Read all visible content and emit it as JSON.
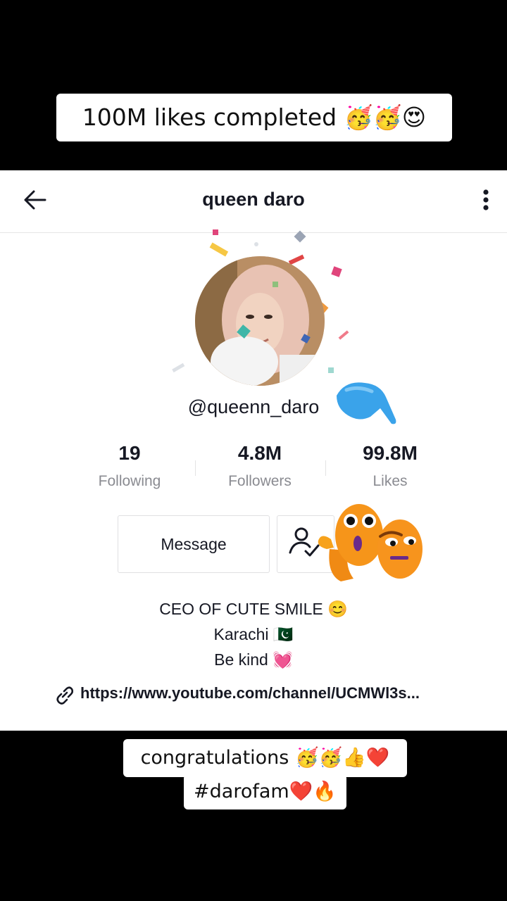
{
  "overlay": {
    "top_caption": "100M likes completed 🥳🥳😍",
    "bottom_caption_line1": "congratulations 🥳🥳👍❤️",
    "bottom_caption_line2": "#darofam❤️🔥"
  },
  "header": {
    "title": "queen daro",
    "back_icon": "arrow-left-icon",
    "more_icon": "more-vertical-icon"
  },
  "profile": {
    "username": "@queenn_daro",
    "stats": [
      {
        "value": "19",
        "label": "Following"
      },
      {
        "value": "4.8M",
        "label": "Followers"
      },
      {
        "value": "99.8M",
        "label": "Likes"
      }
    ],
    "message_label": "Message",
    "follow_icon": "user-check-icon",
    "bio": {
      "line1": "CEO OF CUTE SMILE 😊",
      "line2": "Karachi 🇵🇰",
      "line3": "Be kind 💓"
    },
    "link": "https://www.youtube.com/channel/UCMWl3s..."
  },
  "colors": {
    "text": "#161823",
    "muted": "#8a8b91",
    "border": "#e0e0e2"
  }
}
